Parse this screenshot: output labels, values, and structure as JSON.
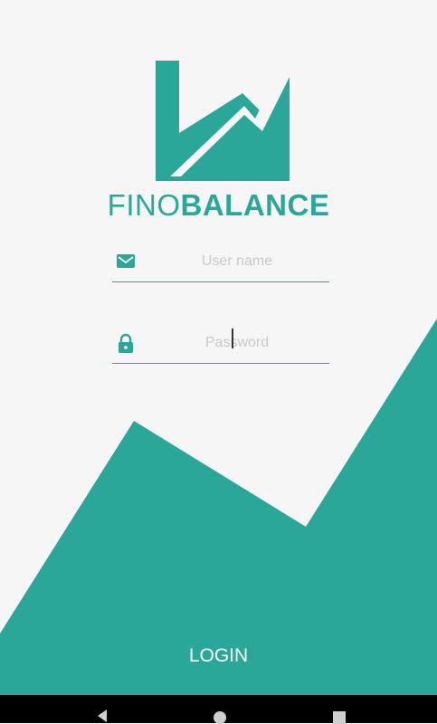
{
  "brand": {
    "light": "FINO",
    "bold": "BALANCE"
  },
  "username": {
    "value": "",
    "placeholder": "User name",
    "icon": "mail-icon"
  },
  "password": {
    "value": "",
    "placeholder": "Password",
    "icon": "lock-icon"
  },
  "login": {
    "label": "LOGIN"
  },
  "colors": {
    "accent": "#2ba79a",
    "background": "#f6f6f6",
    "navbar": "#000000"
  },
  "navbar": {
    "buttons": [
      "back-icon",
      "home-icon",
      "recents-icon"
    ]
  }
}
